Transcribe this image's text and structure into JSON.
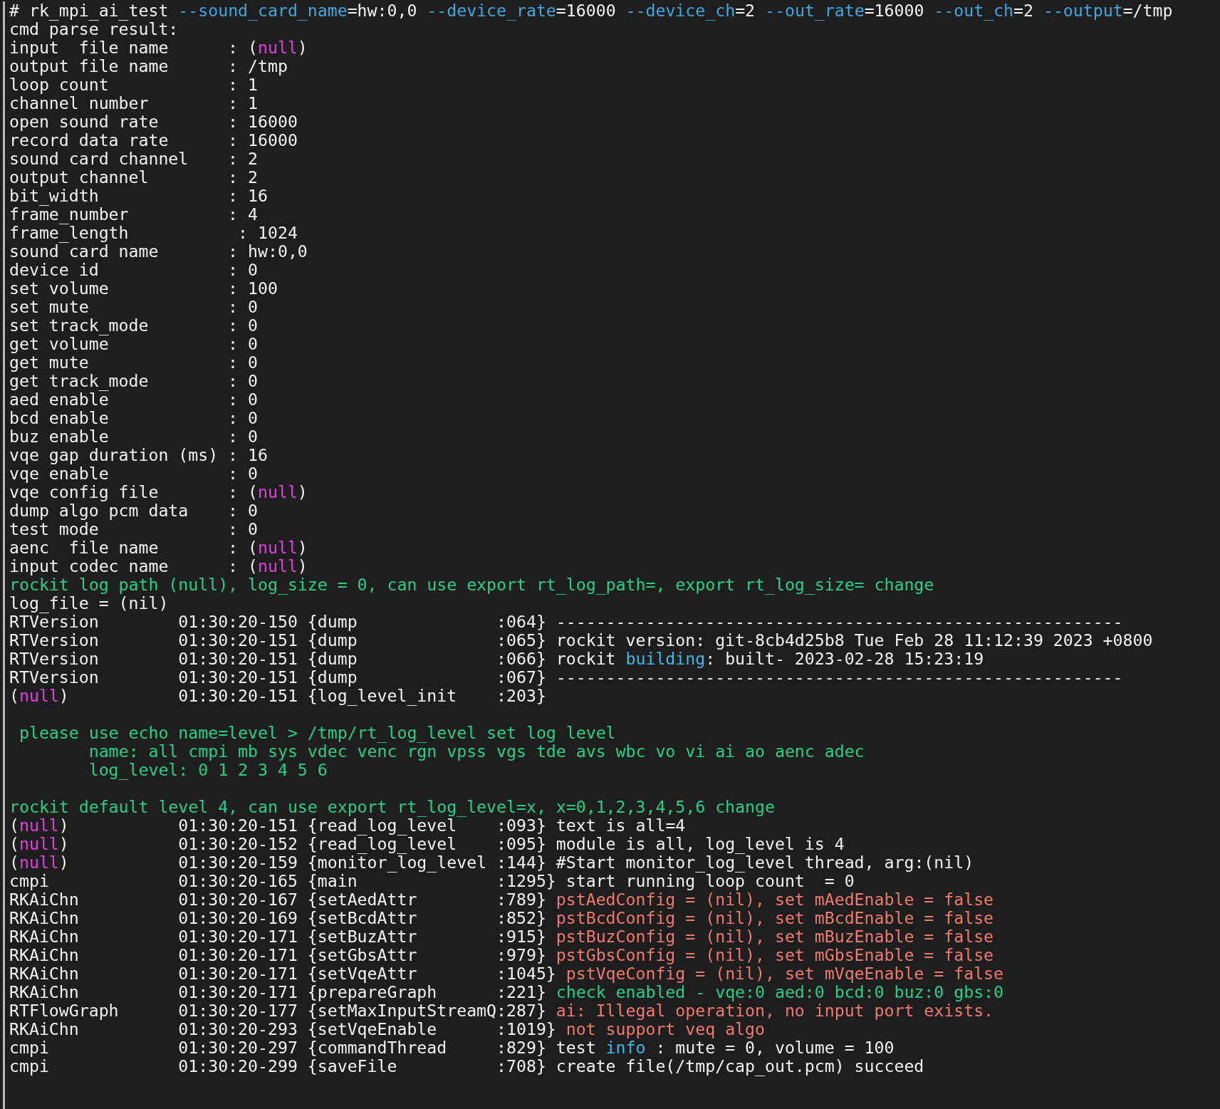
{
  "terminal": {
    "lines": [
      {
        "segments": [
          {
            "text": "# rk_mpi_ai_test"
          },
          {
            "text": " --sound_card_name",
            "color": "#3fa8e0"
          },
          {
            "text": "=hw:0,0 "
          },
          {
            "text": "--device_rate",
            "color": "#3fa8e0"
          },
          {
            "text": "=16000 "
          },
          {
            "text": "--device_ch",
            "color": "#3fa8e0"
          },
          {
            "text": "=2 "
          },
          {
            "text": "--out_rate",
            "color": "#3fa8e0"
          },
          {
            "text": "=16000 "
          },
          {
            "text": "--out_ch",
            "color": "#3fa8e0"
          },
          {
            "text": "=2 "
          },
          {
            "text": "--output",
            "color": "#3fa8e0"
          },
          {
            "text": "=/tmp"
          }
        ]
      },
      {
        "segments": [
          {
            "text": "cmd parse result:"
          }
        ]
      },
      {
        "segments": [
          {
            "text": "input  file name      : ("
          },
          {
            "text": "null",
            "color": "#e040e0"
          },
          {
            "text": ")"
          }
        ]
      },
      {
        "segments": [
          {
            "text": "output file name      : /tmp"
          }
        ]
      },
      {
        "segments": [
          {
            "text": "loop count            : 1"
          }
        ]
      },
      {
        "segments": [
          {
            "text": "channel number        : 1"
          }
        ]
      },
      {
        "segments": [
          {
            "text": "open sound rate       : 16000"
          }
        ]
      },
      {
        "segments": [
          {
            "text": "record data rate      : 16000"
          }
        ]
      },
      {
        "segments": [
          {
            "text": "sound card channel    : 2"
          }
        ]
      },
      {
        "segments": [
          {
            "text": "output channel        : 2"
          }
        ]
      },
      {
        "segments": [
          {
            "text": "bit_width             : 16"
          }
        ]
      },
      {
        "segments": [
          {
            "text": "frame_number          : 4"
          }
        ]
      },
      {
        "segments": [
          {
            "text": "frame_length           : 1024"
          }
        ]
      },
      {
        "segments": [
          {
            "text": "sound card name       : hw:0,0"
          }
        ]
      },
      {
        "segments": [
          {
            "text": "device id             : 0"
          }
        ]
      },
      {
        "segments": [
          {
            "text": "set volume            : 100"
          }
        ]
      },
      {
        "segments": [
          {
            "text": "set mute              : 0"
          }
        ]
      },
      {
        "segments": [
          {
            "text": "set track_mode        : 0"
          }
        ]
      },
      {
        "segments": [
          {
            "text": "get volume            : 0"
          }
        ]
      },
      {
        "segments": [
          {
            "text": "get mute              : 0"
          }
        ]
      },
      {
        "segments": [
          {
            "text": "get track_mode        : 0"
          }
        ]
      },
      {
        "segments": [
          {
            "text": "aed enable            : 0"
          }
        ]
      },
      {
        "segments": [
          {
            "text": "bcd enable            : 0"
          }
        ]
      },
      {
        "segments": [
          {
            "text": "buz enable            : 0"
          }
        ]
      },
      {
        "segments": [
          {
            "text": "vqe gap duration (ms) : 16"
          }
        ]
      },
      {
        "segments": [
          {
            "text": "vqe enable            : 0"
          }
        ]
      },
      {
        "segments": [
          {
            "text": "vqe config file       : ("
          },
          {
            "text": "null",
            "color": "#e040e0"
          },
          {
            "text": ")"
          }
        ]
      },
      {
        "segments": [
          {
            "text": "dump algo pcm data    : 0"
          }
        ]
      },
      {
        "segments": [
          {
            "text": "test mode             : 0"
          }
        ]
      },
      {
        "segments": [
          {
            "text": "aenc  file name       : ("
          },
          {
            "text": "null",
            "color": "#e040e0"
          },
          {
            "text": ")"
          }
        ]
      },
      {
        "segments": [
          {
            "text": "input codec name      : ("
          },
          {
            "text": "null",
            "color": "#e040e0"
          },
          {
            "text": ")"
          }
        ]
      },
      {
        "segments": [
          {
            "text": "rockit log path (null), log_size = 0, can use export rt_log_path=, export rt_log_size= change",
            "color": "#23d18b"
          }
        ]
      },
      {
        "segments": [
          {
            "text": "log_file = (nil)"
          }
        ]
      },
      {
        "segments": [
          {
            "text": "RTVersion        01:30:20-150 {dump              :064} ---------------------------------------------------------"
          }
        ]
      },
      {
        "segments": [
          {
            "text": "RTVersion        01:30:20-151 {dump              :065} rockit version: git-8cb4d25b8 Tue Feb 28 11:12:39 2023 +0800"
          }
        ]
      },
      {
        "segments": [
          {
            "text": "RTVersion        01:30:20-151 {dump              :066} rockit "
          },
          {
            "text": "building",
            "color": "#3fb8e8"
          },
          {
            "text": ": built- 2023-02-28 15:23:19"
          }
        ]
      },
      {
        "segments": [
          {
            "text": "RTVersion        01:30:20-151 {dump              :067} ---------------------------------------------------------"
          }
        ]
      },
      {
        "segments": [
          {
            "text": "("
          },
          {
            "text": "null",
            "color": "#e040e0"
          },
          {
            "text": ")           01:30:20-151 {log_level_init    :203}"
          }
        ]
      },
      {
        "blank_before": true,
        "segments": [
          {
            "text": " please use echo name=level > /tmp/rt_log_level set log level",
            "color": "#23d18b"
          }
        ]
      },
      {
        "segments": [
          {
            "text": "        name: all cmpi mb sys vdec venc rgn vpss vgs tde avs wbc vo vi ai ao aenc adec",
            "color": "#23d18b"
          }
        ]
      },
      {
        "segments": [
          {
            "text": "        log_level: 0 1 2 3 4 5 6",
            "color": "#23d18b"
          }
        ]
      },
      {
        "blank_before": true,
        "segments": [
          {
            "text": "rockit default level 4, can use export rt_log_level=x, x=0,1,2,3,4,5,6 change",
            "color": "#23d18b"
          }
        ]
      },
      {
        "segments": [
          {
            "text": "("
          },
          {
            "text": "null",
            "color": "#e040e0"
          },
          {
            "text": ")           01:30:20-151 {read_log_level    :093} text is all=4"
          }
        ]
      },
      {
        "segments": [
          {
            "text": "("
          },
          {
            "text": "null",
            "color": "#e040e0"
          },
          {
            "text": ")           01:30:20-152 {read_log_level    :095} module is all, log_level is 4"
          }
        ]
      },
      {
        "segments": [
          {
            "text": "("
          },
          {
            "text": "null",
            "color": "#e040e0"
          },
          {
            "text": ")           01:30:20-159 {monitor_log_level :144} #Start monitor_log_level thread, arg:(nil)"
          }
        ]
      },
      {
        "segments": [
          {
            "text": "cmpi             01:30:20-165 {main              :1295} start running loop count  = 0"
          }
        ]
      },
      {
        "segments": [
          {
            "text": "RKAiChn          01:30:20-167 {setAedAttr        :789} "
          },
          {
            "text": "pstAedConfig = (nil), set mAedEnable = false",
            "color": "#f07a6e"
          }
        ]
      },
      {
        "segments": [
          {
            "text": "RKAiChn          01:30:20-169 {setBcdAttr        :852} "
          },
          {
            "text": "pstBcdConfig = (nil), set mBcdEnable = false",
            "color": "#f07a6e"
          }
        ]
      },
      {
        "segments": [
          {
            "text": "RKAiChn          01:30:20-171 {setBuzAttr        :915} "
          },
          {
            "text": "pstBuzConfig = (nil), set mBuzEnable = false",
            "color": "#f07a6e"
          }
        ]
      },
      {
        "segments": [
          {
            "text": "RKAiChn          01:30:20-171 {setGbsAttr        :979} "
          },
          {
            "text": "pstGbsConfig = (nil), set mGbsEnable = false",
            "color": "#f07a6e"
          }
        ]
      },
      {
        "segments": [
          {
            "text": "RKAiChn          01:30:20-171 {setVqeAttr        :1045} "
          },
          {
            "text": "pstVqeConfig = (nil), set mVqeEnable = false",
            "color": "#f07a6e"
          }
        ]
      },
      {
        "segments": [
          {
            "text": "RKAiChn          01:30:20-171 {prepareGraph      :221} "
          },
          {
            "text": "check enabled - vqe:0 aed:0 bcd:0 buz:0 gbs:0",
            "color": "#23d18b"
          }
        ]
      },
      {
        "segments": [
          {
            "text": "RTFlowGraph      01:30:20-177 {setMaxInputStreamQ:287} "
          },
          {
            "text": "ai: Illegal operation, no input port exists.",
            "color": "#f07a6e"
          }
        ]
      },
      {
        "segments": [
          {
            "text": "RKAiChn          01:30:20-293 {setVqeEnable      :1019} "
          },
          {
            "text": "not support veq algo",
            "color": "#f07a6e"
          }
        ]
      },
      {
        "segments": [
          {
            "text": "cmpi             01:30:20-297 {commandThread     :829} test "
          },
          {
            "text": "info",
            "color": "#3fb8e8"
          },
          {
            "text": " : mute = 0, volume = 100"
          }
        ]
      },
      {
        "segments": [
          {
            "text": "cmpi             01:30:20-299 {saveFile          :708} create file(/tmp/cap_out.pcm) succeed"
          }
        ]
      }
    ]
  }
}
